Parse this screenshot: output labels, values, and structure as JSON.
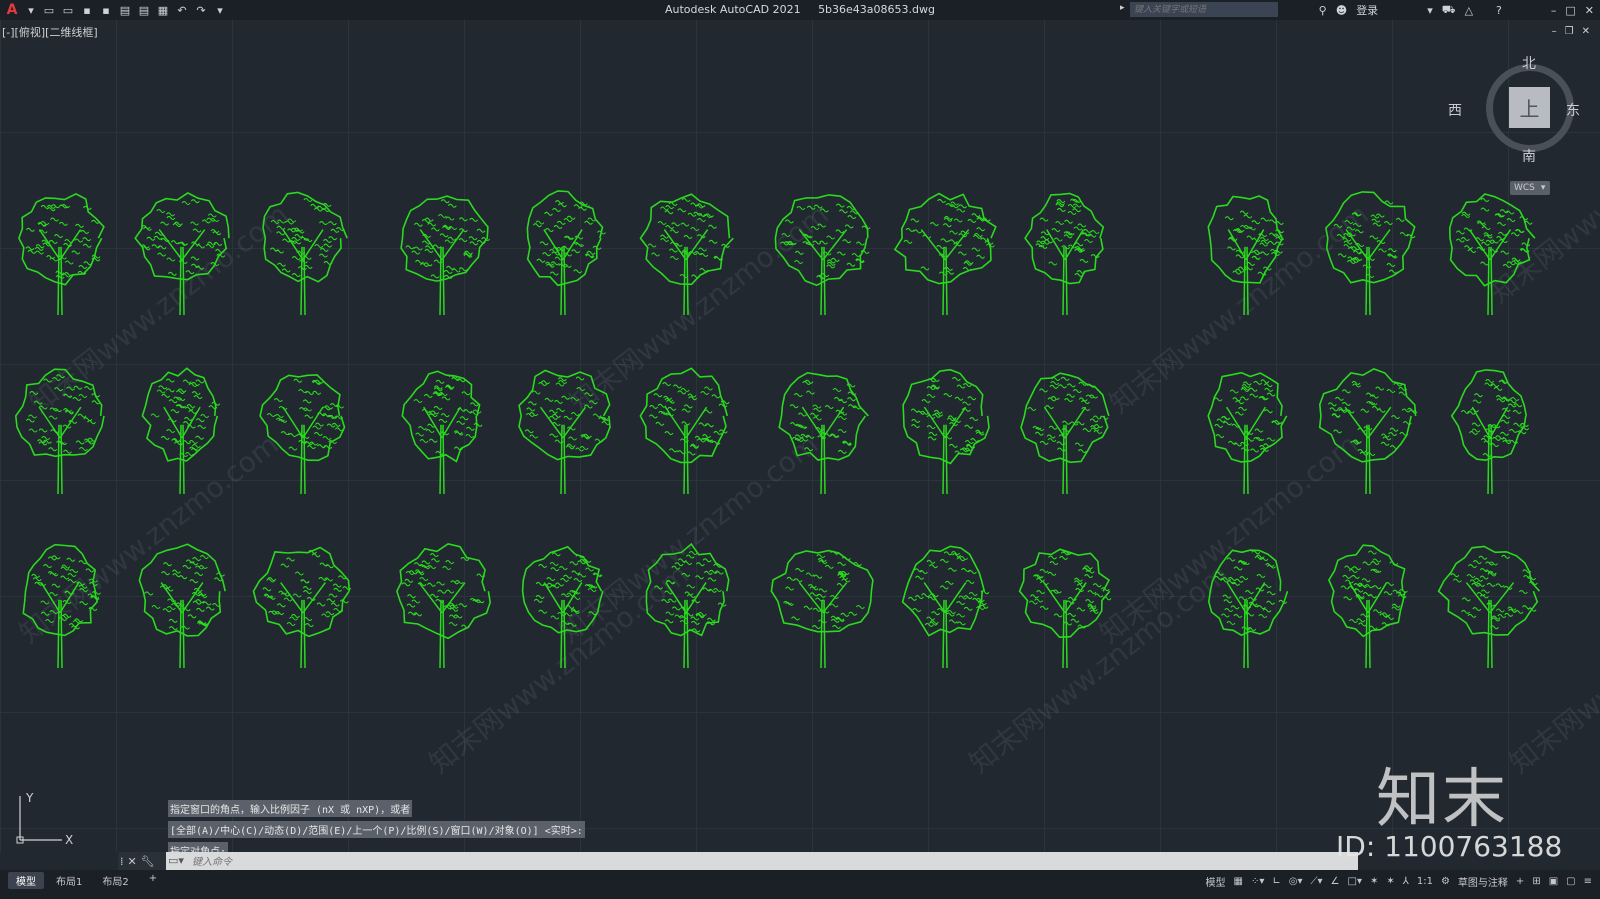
{
  "titlebar": {
    "app": "Autodesk AutoCAD 2021",
    "file": "5b36e43a08653.dwg",
    "search_placeholder": "键入关键字或短语",
    "login": "登录",
    "logo_glyph": "A",
    "qat": [
      {
        "name": "new-file-icon",
        "glyph": "▭"
      },
      {
        "name": "open-file-icon",
        "glyph": "▭"
      },
      {
        "name": "save-icon",
        "glyph": "▪"
      },
      {
        "name": "save-as-icon",
        "glyph": "▪"
      },
      {
        "name": "plot-preview-icon",
        "glyph": "▤"
      },
      {
        "name": "publish-icon",
        "glyph": "▤"
      },
      {
        "name": "print-icon",
        "glyph": "▦"
      },
      {
        "name": "undo-icon",
        "glyph": "↶"
      },
      {
        "name": "redo-icon",
        "glyph": "↷"
      },
      {
        "name": "customize-qat-icon",
        "glyph": "▾"
      }
    ]
  },
  "viewport": {
    "label": "[-][俯视][二维线框]",
    "viewcube": {
      "north": "北",
      "south": "南",
      "east": "东",
      "west": "西",
      "face": "上"
    },
    "wcs": "WCS"
  },
  "watermark": {
    "text": "知末网www.znzmo.com"
  },
  "command": {
    "history": [
      "指定窗口的角点，输入比例因子 (nX 或 nXP)，或者",
      "[全部(A)/中心(C)/动态(D)/范围(E)/上一个(P)/比例(S)/窗口(W)/对象(O)] <实时>:",
      "指定对角点:"
    ],
    "placeholder": "键入命令"
  },
  "ucs": {
    "x": "X",
    "y": "Y"
  },
  "layout_tabs": [
    "模型",
    "布局1",
    "布局2",
    "+"
  ],
  "status": {
    "model": "模型",
    "scale": "1:1",
    "workspace": "草图与注释"
  },
  "brand": {
    "name": "知末",
    "id": "ID: 1100763188"
  },
  "colors": {
    "tree": "#2bd91f",
    "canvas": "#212830"
  }
}
